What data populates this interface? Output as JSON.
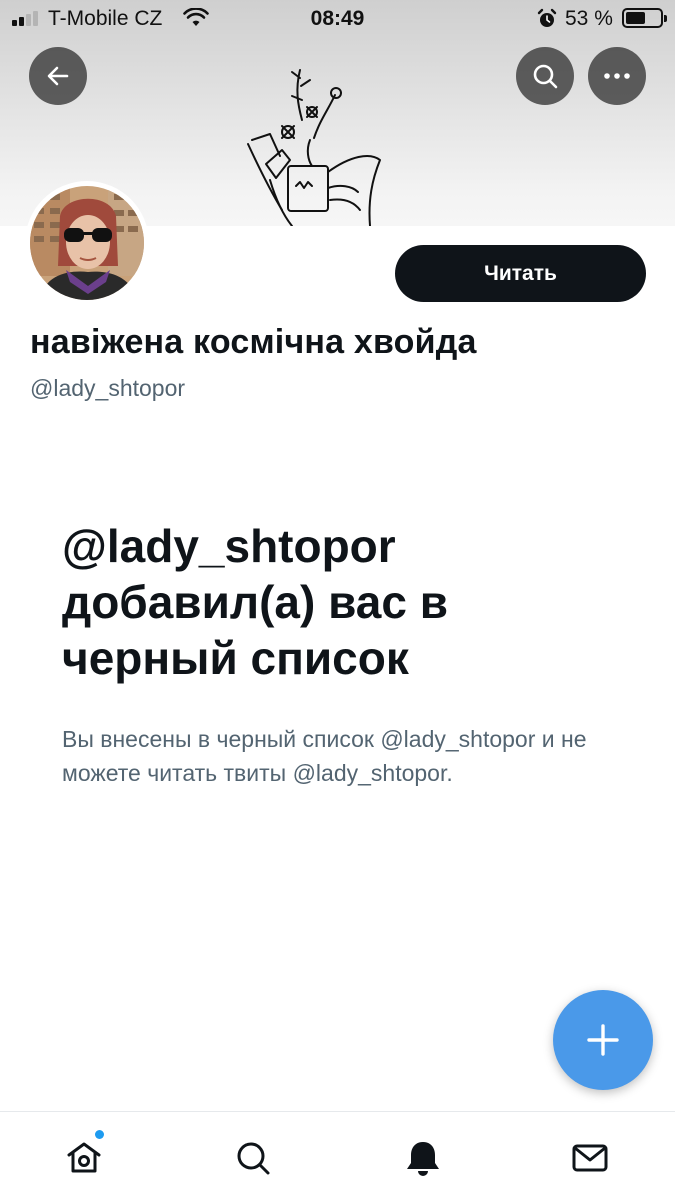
{
  "status_bar": {
    "carrier": "T-Mobile CZ",
    "time": "08:49",
    "battery_percent": "53 %",
    "battery_level": 0.53
  },
  "header": {
    "back_icon": "arrow-left-icon",
    "search_icon": "search-icon",
    "more_icon": "more-horizontal-icon"
  },
  "profile": {
    "display_name": "навіжена космічна хвойда",
    "username": "@lady_shtopor",
    "follow_label": "Читать"
  },
  "blocked_notice": {
    "title": "@lady_shtopor добавил(а) вас в черный список",
    "description": "Вы внесены в черный список @lady_shtopor и не можете читать твиты @lady_shtopor."
  },
  "compose": {
    "icon": "plus-icon"
  },
  "tab_bar": {
    "items": [
      {
        "name": "home",
        "icon": "home-icon",
        "has_notification_dot": true
      },
      {
        "name": "search",
        "icon": "search-icon"
      },
      {
        "name": "notifications",
        "icon": "bell-icon"
      },
      {
        "name": "messages",
        "icon": "mail-icon"
      }
    ]
  },
  "colors": {
    "primary_text": "#0f1419",
    "secondary_text": "#536471",
    "accent": "#4a99e9",
    "notification_dot": "#1d9bf0"
  }
}
